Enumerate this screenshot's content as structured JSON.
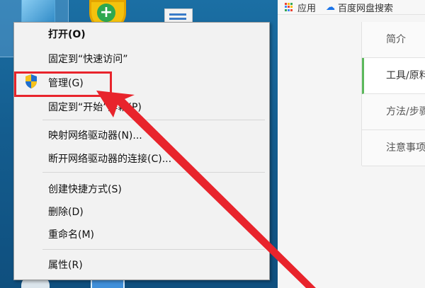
{
  "browser": {
    "bookmarks": [
      {
        "label": "应用",
        "icon": "apps-grid-icon"
      },
      {
        "label": "百度网盘搜索",
        "icon": "baidu-cloud-icon"
      }
    ],
    "toc": [
      {
        "label": "简介",
        "active": false
      },
      {
        "label": "工具/原料",
        "active": true
      },
      {
        "label": "方法/步骤",
        "active": false
      },
      {
        "label": "注意事项",
        "active": false
      }
    ]
  },
  "context_menu": {
    "items": [
      {
        "label": "打开(O)",
        "bold": true
      },
      {
        "label": "固定到“快速访问”",
        "bold": false
      },
      {
        "label": "管理(G)",
        "bold": false,
        "icon": "uac-shield-icon",
        "highlighted": true
      },
      {
        "label": "固定到“开始”屏幕(P)",
        "bold": false
      },
      {
        "label": "映射网络驱动器(N)...",
        "bold": false
      },
      {
        "label": "断开网络驱动器的连接(C)...",
        "bold": false
      },
      {
        "label": "创建快捷方式(S)",
        "bold": false
      },
      {
        "label": "删除(D)",
        "bold": false
      },
      {
        "label": "重命名(M)",
        "bold": false
      },
      {
        "label": "属性(R)",
        "bold": false
      }
    ]
  },
  "colors": {
    "highlight": "#e8242c",
    "desktop": "#1b6fa4",
    "toc_active": "#5cb85c"
  }
}
